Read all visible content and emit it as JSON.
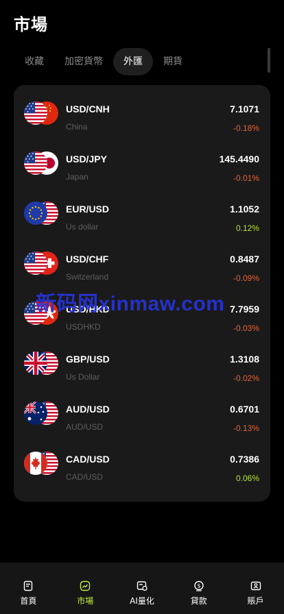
{
  "header": {
    "title": "市場"
  },
  "tabs": [
    {
      "label": "收藏"
    },
    {
      "label": "加密貨幣"
    },
    {
      "label": "外匯",
      "active": true
    },
    {
      "label": "期貨"
    }
  ],
  "rows": [
    {
      "pair": "USD/CNH",
      "sub": "China",
      "price": "7.1071",
      "change": "-0.18%",
      "direction": "down",
      "flags": [
        "us-flag",
        "cn-flag"
      ]
    },
    {
      "pair": "USD/JPY",
      "sub": "Japan",
      "price": "145.4490",
      "change": "-0.01%",
      "direction": "down",
      "flags": [
        "us-flag",
        "jp-flag"
      ]
    },
    {
      "pair": "EUR/USD",
      "sub": "Us dollar",
      "price": "1.1052",
      "change": "0.12%",
      "direction": "up",
      "flags": [
        "eu-flag",
        "us-flag"
      ]
    },
    {
      "pair": "USD/CHF",
      "sub": "Switzerland",
      "price": "0.8487",
      "change": "-0.09%",
      "direction": "down",
      "flags": [
        "us-flag",
        "ch-flag"
      ]
    },
    {
      "pair": "USD/HKD",
      "sub": "USDHKD",
      "price": "7.7959",
      "change": "-0.03%",
      "direction": "down",
      "flags": [
        "us-flag",
        "hk-flag"
      ]
    },
    {
      "pair": "GBP/USD",
      "sub": "Us Dollar",
      "price": "1.3108",
      "change": "-0.02%",
      "direction": "down",
      "flags": [
        "gb-flag",
        "us-flag"
      ]
    },
    {
      "pair": "AUD/USD",
      "sub": "AUD/USD",
      "price": "0.6701",
      "change": "-0.13%",
      "direction": "down",
      "flags": [
        "au-flag",
        "us-flag"
      ]
    },
    {
      "pair": "CAD/USD",
      "sub": "CAD/USD",
      "price": "0.7386",
      "change": "0.06%",
      "direction": "up",
      "flags": [
        "ca-flag",
        "us-flag"
      ]
    }
  ],
  "watermark": "新码网xinmaw.com",
  "nav": [
    {
      "label": "首頁",
      "icon": "home-icon"
    },
    {
      "label": "市場",
      "icon": "market-chart-icon",
      "active": true
    },
    {
      "label": "AI量化",
      "icon": "ai-quant-icon"
    },
    {
      "label": "貸款",
      "icon": "loan-icon"
    },
    {
      "label": "賬戶",
      "icon": "account-icon"
    }
  ],
  "colors": {
    "accent": "#c4ef3c",
    "down": "#e0653a",
    "up": "#b6e33c",
    "card": "#1a1a1a"
  }
}
